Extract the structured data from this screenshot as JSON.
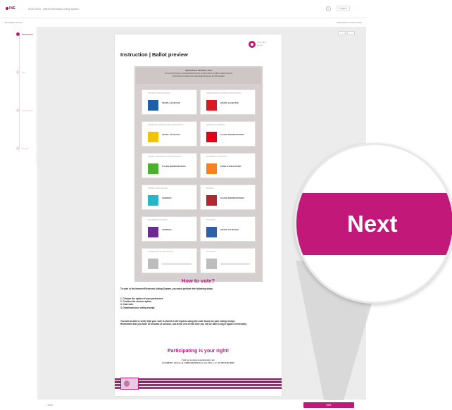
{
  "header": {
    "logo": "INE",
    "title": "SIVEI 2024 · Internet Electronic Voting System",
    "lang": "English",
    "help": "?",
    "menu": "⋮"
  },
  "subbar": {
    "left": "Information of voter",
    "right": "Instructions on how to vote"
  },
  "sidebar": {
    "steps": [
      {
        "label": "Instructions"
      },
      {
        "label": "Vote"
      },
      {
        "label": "Confirmation"
      },
      {
        "label": "Receipt"
      }
    ]
  },
  "content": {
    "mini_button": "Exit",
    "user_line1": "Voter name",
    "user_line2": "Mexico",
    "doc_title": "Instruction | Ballot preview",
    "ballot": {
      "header": [
        "PROCESO ELECTORAL 2024",
        "VOTACIÓN PARA LA PRESIDENCIA DE LOS ESTADOS UNIDOS MEXICANOS",
        "CIUDADANO MEXICANO RESIDENTE EN EL EXTRANJERO"
      ],
      "candidates": [
        {
          "party": "PARTIDO ACCIÓN NACIONAL",
          "name": "XÓCHITL GÁLVEZ RUIZ",
          "color": "#1f5fa8"
        },
        {
          "party": "PARTIDO REVOLUCIONARIO INSTITUCIONAL",
          "name": "XÓCHITL GÁLVEZ RUIZ",
          "color": "#d71920"
        },
        {
          "party": "PARTIDO DE LA REVOLUCIÓN DEMOCRÁTICA",
          "name": "XÓCHITL GÁLVEZ RUIZ",
          "color": "#f2c300"
        },
        {
          "party": "PARTIDO DEL TRABAJO",
          "name": "CLAUDIA SHEINBAUM PARDO",
          "color": "#e2001a"
        },
        {
          "party": "PARTIDO VERDE ECOLOGISTA DE MÉXICO",
          "name": "CLAUDIA SHEINBAUM PARDO",
          "color": "#4caf32"
        },
        {
          "party": "MOVIMIENTO CIUDADANO",
          "name": "JORGE ÁLVAREZ MÁYNEZ",
          "color": "#f7811f"
        },
        {
          "party": "PARTIDO NUEVA ALIANZA",
          "name": "CANDIDATO",
          "color": "#27b5c9"
        },
        {
          "party": "MORENA",
          "name": "CLAUDIA SHEINBAUM PARDO",
          "color": "#b3282d"
        },
        {
          "party": "ENCUENTRO SOLIDARIO",
          "name": "CANDIDATO",
          "color": "#6b2c91"
        },
        {
          "party": "COALICIÓN",
          "name": "XÓCHITL GÁLVEZ RUIZ",
          "color": "#2e5fa8"
        },
        {
          "party": "CANDIDATURA NO REGISTRADA",
          "name": "",
          "color": "#bdbdbd"
        },
        {
          "party": "VOTO NULO",
          "name": "",
          "color": "#bdbdbd"
        }
      ]
    },
    "how_heading": "How to vote?",
    "how_intro": "To vote in the Internet Electronic Voting System, you must perform the following steps:",
    "steps": [
      "1. Choose the option of your preference.",
      "2. Confirm the chosen option.",
      "3. Cast vote.",
      "4. Download your voting receipt."
    ],
    "verify_text": "You will be able to verify that your vote is stored in the System using the code found on your voting receipt.",
    "remember_text": "Remember that you have 30 minutes of session, but at the end of this time you will be able to log in again if necessary.",
    "participating_heading": "Participating is your right!",
    "find_line": "Find out at www.votoextranjero.mx",
    "call_line": "Call INETEL toll free at 1 (866) 986 8306 from the USA or at +52 (55) 5481 9897"
  },
  "footer": {
    "back": "← Back",
    "next": "Next"
  },
  "magnifier": {
    "label": "Next"
  },
  "colors": {
    "accent": "#c2187a",
    "heading_magenta": "#b4177a"
  }
}
